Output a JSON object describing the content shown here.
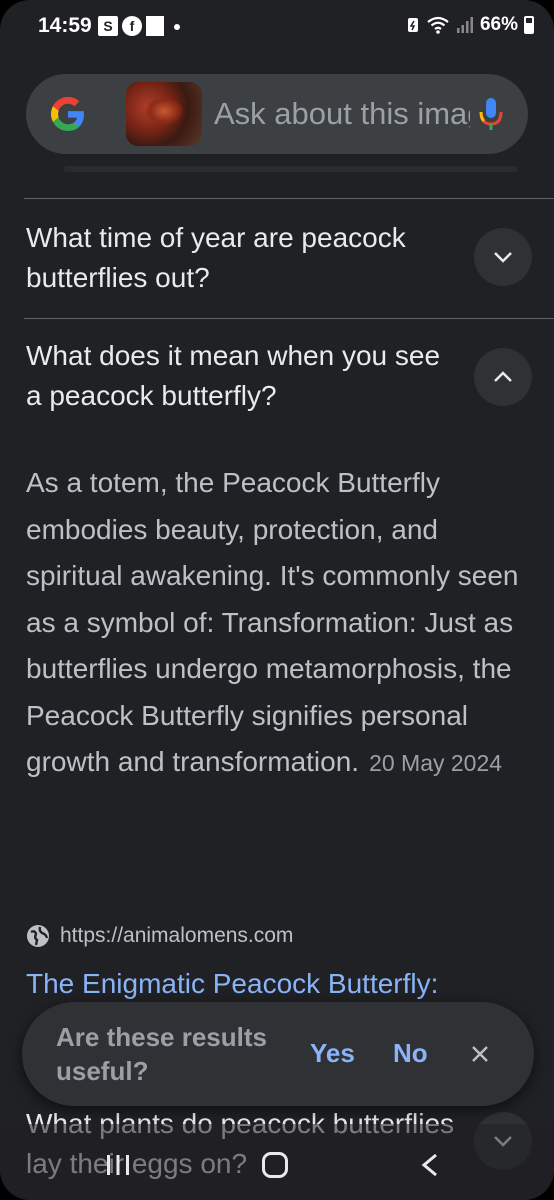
{
  "status_bar": {
    "time": "14:59",
    "notification_s": "S",
    "notification_fb": "f",
    "battery": "66%"
  },
  "search": {
    "placeholder": "Ask about this image",
    "icons": [
      "google-logo",
      "image-thumbnail",
      "mic-icon"
    ]
  },
  "questions": [
    {
      "text": "What time of year are peacock butterflies out?",
      "expanded": false
    },
    {
      "text": "What does it mean when you see a peacock butterfly?",
      "expanded": true
    },
    {
      "text": "What plants do peacock butterflies lay their eggs on?",
      "expanded": false
    }
  ],
  "answer": {
    "body": "As a totem, the Peacock Butterfly embodies beauty, protection, and spiritual awakening. It's commonly seen as a symbol of: Transformation: Just as butterflies undergo metamorphosis, the Peacock Butterfly signifies personal growth and transformation.",
    "date": "20 May 2024",
    "source_url": "https://animalomens.com",
    "link_title": "The Enigmatic Peacock Butterfly:"
  },
  "feedback": {
    "question": "Are these results useful?",
    "yes": "Yes",
    "no": "No"
  },
  "colors": {
    "background": "#202124",
    "link": "#8ab4f8",
    "text": "#e8eaed"
  }
}
